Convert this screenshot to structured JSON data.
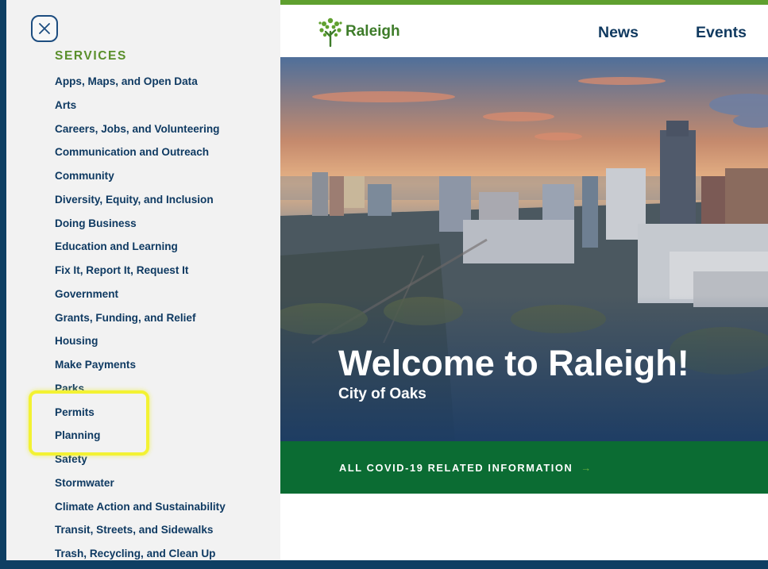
{
  "drawer": {
    "close_icon": "close-icon",
    "heading": "SERVICES",
    "items": [
      "Apps, Maps, and Open Data",
      "Arts",
      "Careers, Jobs, and Volunteering",
      "Communication and Outreach",
      "Community",
      "Diversity, Equity, and Inclusion",
      "Doing Business",
      "Education and Learning",
      "Fix It, Report It, Request It",
      "Government",
      "Grants, Funding, and Relief",
      "Housing",
      "Make Payments",
      "Parks",
      "Permits",
      "Planning",
      "Safety",
      "Stormwater",
      "Climate Action and Sustainability",
      "Transit, Streets, and Sidewalks",
      "Trash, Recycling, and Clean Up"
    ],
    "highlight_color": "#f3f233"
  },
  "header": {
    "logo_text": "Raleigh",
    "logo_icon": "oak-tree-logo-icon",
    "nav": [
      "News",
      "Events"
    ]
  },
  "hero": {
    "title": "Welcome to Raleigh!",
    "subtitle": "City of Oaks"
  },
  "banner": {
    "link_text": "ALL COVID-19 RELATED INFORMATION",
    "arrow": "→",
    "bg_color": "#0b6c33"
  },
  "colors": {
    "sidebar_text": "#0f3a62",
    "heading_green": "#5a8f2b",
    "page_bg": "#0e3f63"
  }
}
